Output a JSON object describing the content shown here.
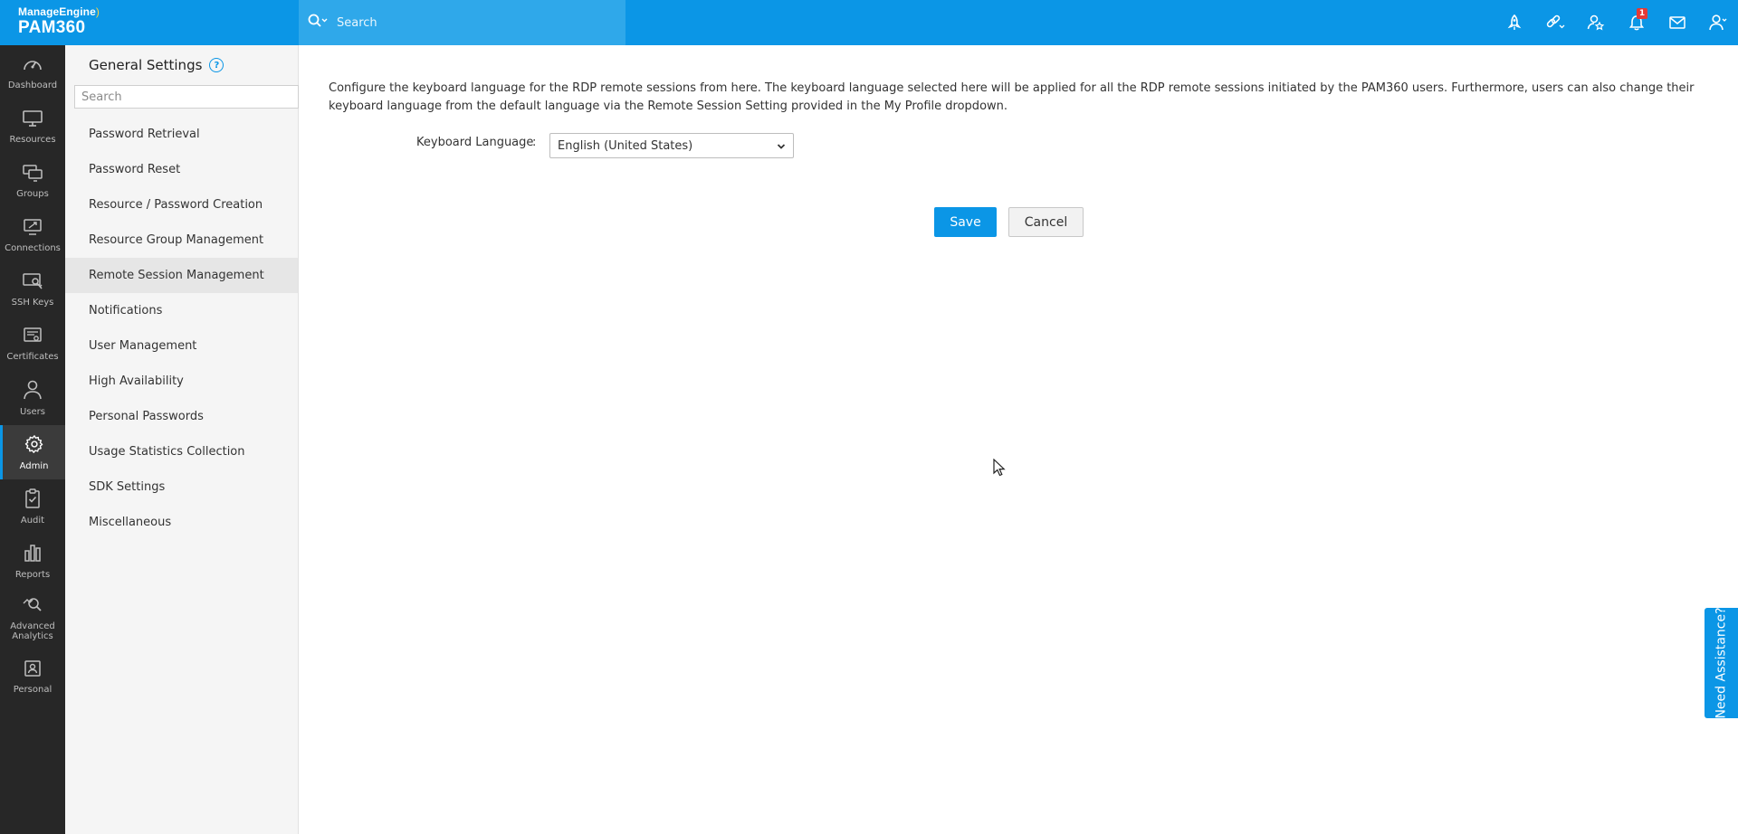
{
  "brand": {
    "company": "ManageEngine",
    "product": "PAM360"
  },
  "topbar": {
    "search_placeholder": "Search",
    "icons": [
      "rocket-icon",
      "link-icon",
      "user-star-icon",
      "bell-icon",
      "mail-icon",
      "user-icon"
    ],
    "notification_count": "1"
  },
  "leftnav": {
    "items": [
      {
        "label": "Dashboard",
        "icon": "dashboard-icon"
      },
      {
        "label": "Resources",
        "icon": "monitor-icon"
      },
      {
        "label": "Groups",
        "icon": "groups-icon"
      },
      {
        "label": "Connections",
        "icon": "connections-icon"
      },
      {
        "label": "SSH Keys",
        "icon": "ssh-key-icon"
      },
      {
        "label": "Certificates",
        "icon": "certificate-icon"
      },
      {
        "label": "Users",
        "icon": "user-icon"
      },
      {
        "label": "Admin",
        "icon": "gear-icon"
      },
      {
        "label": "Audit",
        "icon": "clipboard-icon"
      },
      {
        "label": "Reports",
        "icon": "bar-chart-icon"
      },
      {
        "label": "Advanced Analytics",
        "icon": "analytics-icon"
      },
      {
        "label": "Personal",
        "icon": "contact-card-icon"
      }
    ],
    "active": "Admin"
  },
  "settings_panel": {
    "title": "General Settings",
    "search_placeholder": "Search",
    "items": [
      "Password Retrieval",
      "Password Reset",
      "Resource / Password Creation",
      "Resource Group Management",
      "Remote Session Management",
      "Notifications",
      "User Management",
      "High Availability",
      "Personal Passwords",
      "Usage Statistics Collection",
      "SDK Settings",
      "Miscellaneous"
    ],
    "active": "Remote Session Management"
  },
  "main": {
    "description": "Configure the keyboard language for the RDP remote sessions from here. The keyboard language selected here will be applied for all the RDP remote sessions initiated by the PAM360 users. Furthermore, users can also change their keyboard language from the default language via the Remote Session Setting provided in the My Profile dropdown.",
    "keyboard_label": "Keyboard Language",
    "colon": ":",
    "keyboard_value": "English (United States)",
    "save_label": "Save",
    "cancel_label": "Cancel"
  },
  "assistance_label": "Need Assistance?",
  "colors": {
    "accent": "#0b96e6",
    "nav_bg": "#272727",
    "panel_bg": "#f5f5f5",
    "badge": "#e53935"
  }
}
